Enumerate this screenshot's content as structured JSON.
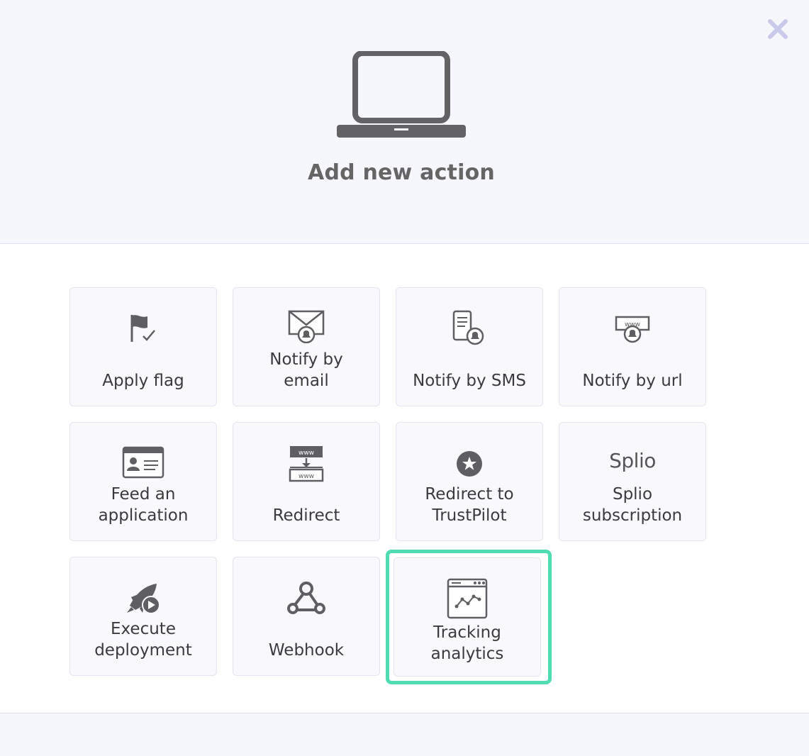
{
  "header": {
    "title": "Add new action",
    "close_icon": "close-icon",
    "hero_icon": "laptop-icon"
  },
  "actions": [
    {
      "label": "Apply flag",
      "icon": "flag-check-icon"
    },
    {
      "label": "Notify by\nemail",
      "icon": "email-bell-icon"
    },
    {
      "label": "Notify by SMS",
      "icon": "sms-bell-icon"
    },
    {
      "label": "Notify by url",
      "icon": "www-bell-icon"
    },
    {
      "label": "Feed an\napplication",
      "icon": "application-card-icon"
    },
    {
      "label": "Redirect",
      "icon": "www-redirect-icon"
    },
    {
      "label": "Redirect to\nTrustPilot",
      "icon": "star-circle-icon"
    },
    {
      "label": "Splio\nsubscription",
      "icon": "splio-logo",
      "logo_text": "Splio"
    },
    {
      "label": "Execute\ndeployment",
      "icon": "rocket-play-icon"
    },
    {
      "label": "Webhook",
      "icon": "webhook-icon"
    },
    {
      "label": "Tracking\nanalytics",
      "icon": "browser-chart-icon",
      "highlighted": true
    }
  ],
  "colors": {
    "header_bg": "#f6f6fd",
    "tile_bg": "#f9f9fd",
    "highlight": "#4fdcb0",
    "icon": "#5f5f63"
  }
}
